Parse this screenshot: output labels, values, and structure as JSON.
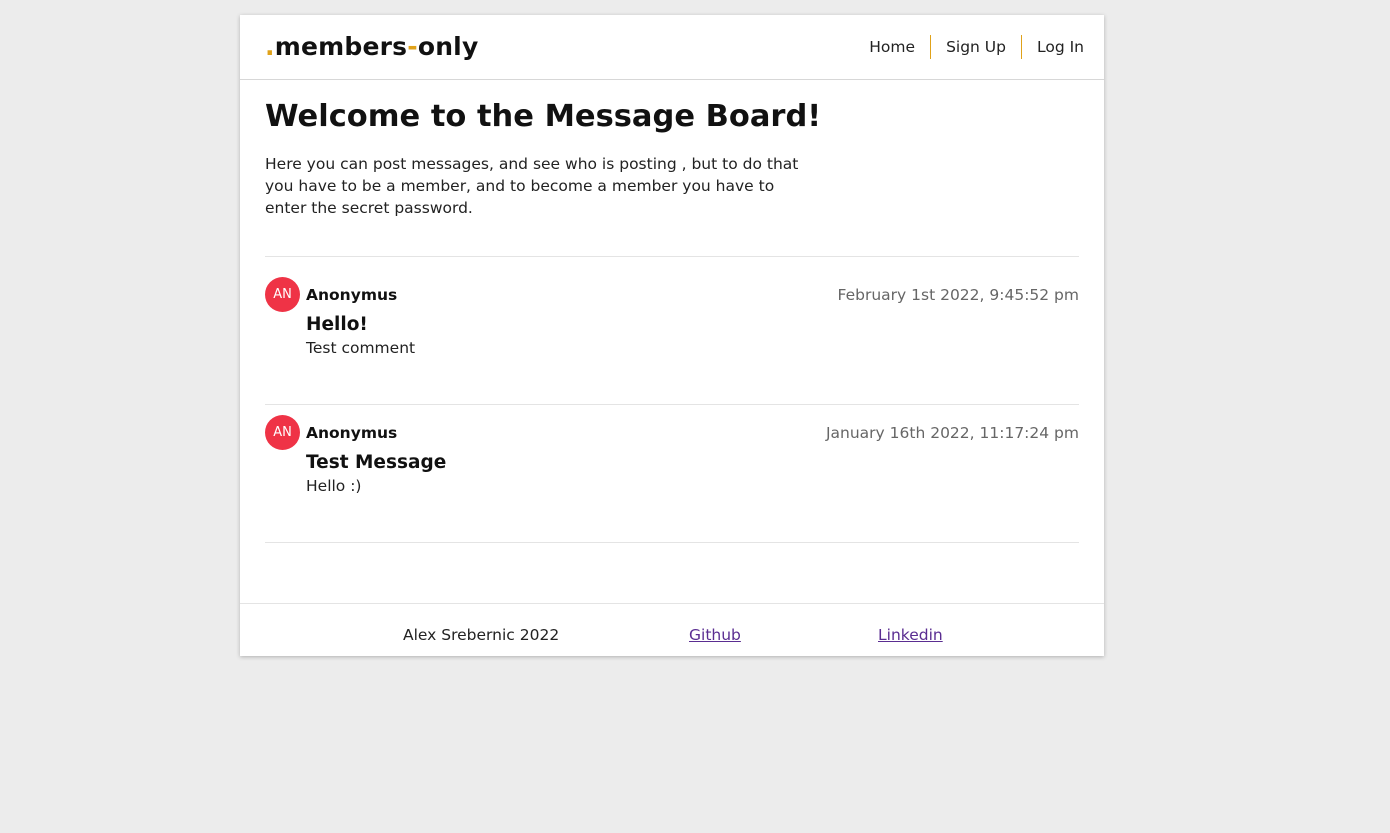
{
  "header": {
    "logo_dot": ".",
    "logo_part1": "members",
    "logo_dash": "-",
    "logo_part2": "only",
    "nav": [
      "Home",
      "Sign Up",
      "Log In"
    ],
    "accent_color": "#e0a21a"
  },
  "main": {
    "title": "Welcome to the Message Board!",
    "intro": "Here you can post messages, and see who is posting , but to do that you have to be a member, and to become a member you have to enter the secret password."
  },
  "messages": [
    {
      "avatar": "AN",
      "author": "Anonymus",
      "date": "February 1st 2022, 9:45:52 pm",
      "title": "Hello!",
      "body": "Test comment"
    },
    {
      "avatar": "AN",
      "author": "Anonymus",
      "date": "January 16th 2022, 11:17:24 pm",
      "title": "Test Message",
      "body": "Hello :)"
    }
  ],
  "avatar_color": "#ef3346",
  "footer": {
    "copyright": "Alex Srebernic 2022",
    "github": "Github",
    "linkedin": "Linkedin"
  }
}
